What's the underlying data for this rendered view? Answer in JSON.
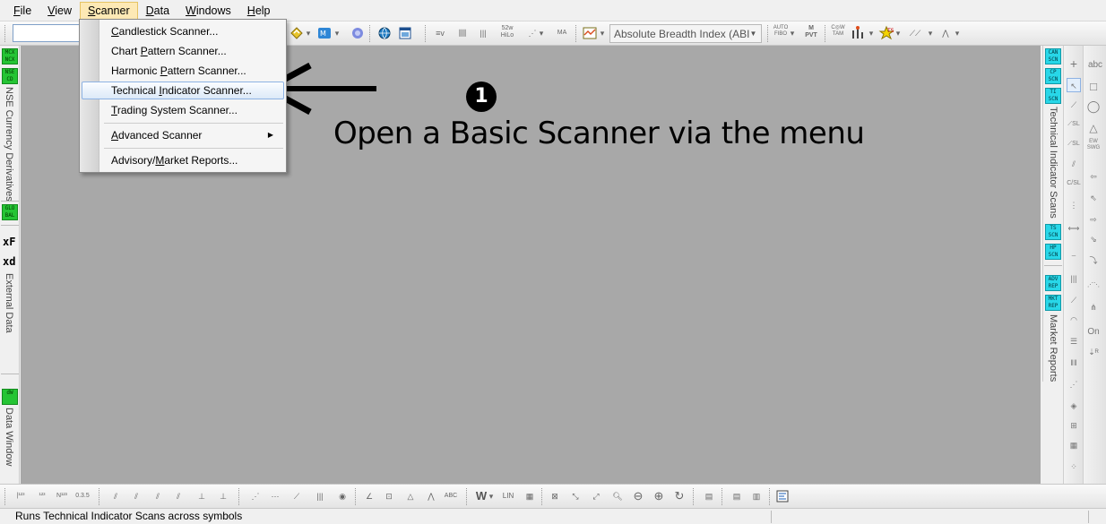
{
  "menubar": {
    "items": [
      {
        "label": "File",
        "underline": "F",
        "rest": "ile"
      },
      {
        "label": "View",
        "underline": "V",
        "rest": "iew"
      },
      {
        "label": "Scanner",
        "underline": "S",
        "rest": "canner"
      },
      {
        "label": "Data",
        "underline": "D",
        "rest": "ata"
      },
      {
        "label": "Windows",
        "underline": "W",
        "rest": "indows"
      },
      {
        "label": "Help",
        "underline": "H",
        "rest": "elp"
      }
    ]
  },
  "scanner_menu": {
    "items": [
      {
        "pre": "",
        "ul": "C",
        "post": "andlestick Scanner..."
      },
      {
        "pre": "Chart ",
        "ul": "P",
        "post": "attern Scanner..."
      },
      {
        "pre": "Harmonic ",
        "ul": "P",
        "post": "attern Scanner..."
      },
      {
        "pre": "Technical ",
        "ul": "I",
        "post": "ndicator Scanner..."
      },
      {
        "pre": "",
        "ul": "T",
        "post": "rading System Scanner..."
      },
      {
        "pre": "",
        "ul": "A",
        "post": "dvanced Scanner"
      },
      {
        "pre": "Advisory/",
        "ul": "M",
        "post": "arket Reports..."
      }
    ],
    "highlighted_index": 3,
    "submenu_arrow": "▶"
  },
  "toolbar_top": {
    "symbol_value": "",
    "indicator_selected": "Absolute Breadth Index (ABI",
    "icons": [
      "auto-fibo-icon",
      "pivot-icon",
      "cow-tam-icon",
      "ts-icon",
      "trendline-icon"
    ]
  },
  "left_strip": {
    "badges": [
      {
        "text": "MCX\nNCX",
        "color": "green"
      },
      {
        "text": "NSE\nCD",
        "color": "green"
      },
      {
        "text": "GLO\nBAL",
        "color": "green"
      },
      {
        "text": "dW",
        "color": "green"
      }
    ],
    "labels": {
      "nse_currency": "NSE Currency Derivatives",
      "external_data": "External Data",
      "data_window": "Data Window"
    },
    "xf": "xF",
    "xd": "xd"
  },
  "annotation": {
    "step_number": "1",
    "text": "Open a Basic Scanner via the menu"
  },
  "right_scan_strip": {
    "badges": [
      {
        "text": "CAN\nSCN"
      },
      {
        "text": "CP\nSCN"
      },
      {
        "text": "TI\nSCN"
      },
      {
        "text": "TS\nSCN"
      },
      {
        "text": "HP\nSCN"
      },
      {
        "text": "ADV\nREP"
      },
      {
        "text": "MKT\nREP"
      }
    ],
    "labels": {
      "technical_scans": "Technical Indicator Scans",
      "market_reports": "Market Reports"
    }
  },
  "draw_tools_labels": {
    "abc": "abc",
    "ew": "EW\nSWG",
    "on": "On"
  },
  "bottom_toolbar": {
    "labels": {
      "w": "W",
      "lin": "LIN"
    }
  },
  "statusbar": {
    "text": "Runs Technical Indicator Scans across symbols"
  },
  "colors": {
    "canvas": "#a8a8a8",
    "badge_green": "#25c434",
    "badge_cyan": "#28d7e8",
    "menu_open": "#fde9b5",
    "highlight_border": "#8db2e3"
  }
}
